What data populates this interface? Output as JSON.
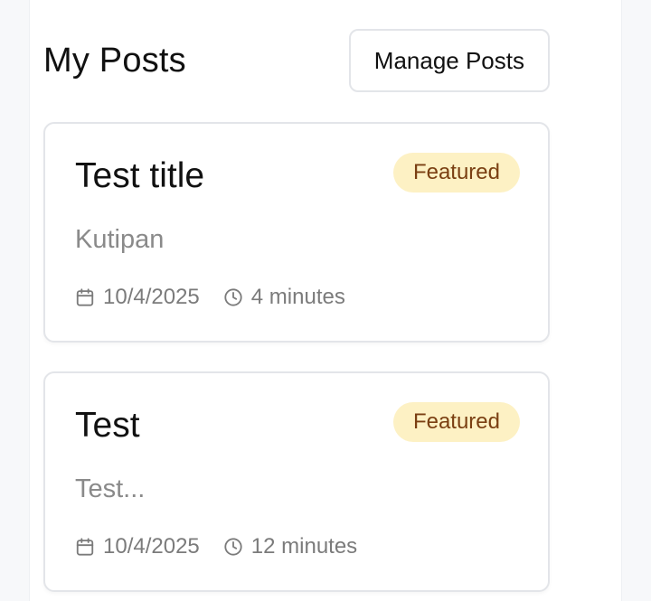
{
  "header": {
    "title": "My Posts",
    "manage_label": "Manage Posts"
  },
  "posts": [
    {
      "title": "Test title",
      "badge": "Featured",
      "excerpt": "Kutipan",
      "date": "10/4/2025",
      "read_time": "4 minutes"
    },
    {
      "title": "Test",
      "badge": "Featured",
      "excerpt": "Test...",
      "date": "10/4/2025",
      "read_time": "12 minutes"
    }
  ],
  "icons": {
    "date": "calendar-icon",
    "read_time": "clock-icon"
  },
  "colors": {
    "badge_bg": "#fdf1c4",
    "badge_text": "#7a3f12",
    "border": "#e3e5e9",
    "muted_text": "#7b7b7b"
  }
}
